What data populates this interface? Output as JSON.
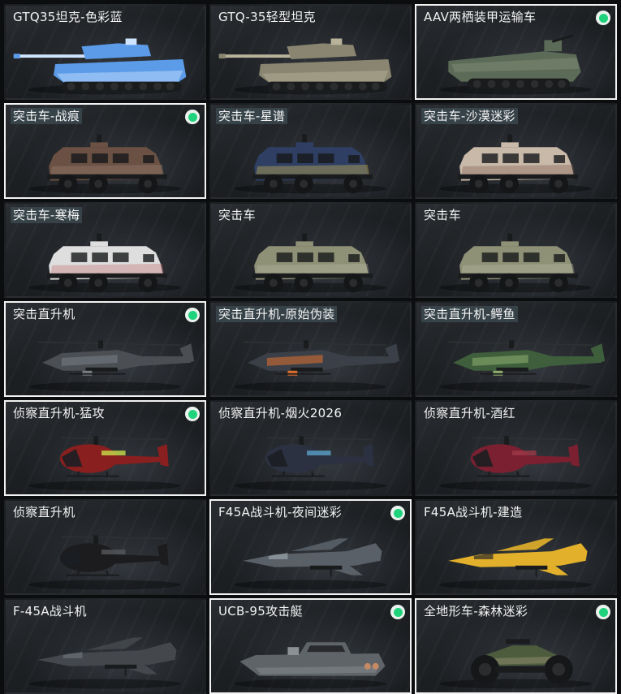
{
  "items": [
    {
      "name": "GTQ35坦克-色彩蓝",
      "kind": "tank",
      "tint": "#5b9be8",
      "accent": "#cfe4ff",
      "owned": false,
      "selected": false,
      "tagged": false
    },
    {
      "name": "GTQ-35轻型坦克",
      "kind": "tank",
      "tint": "#8a8570",
      "accent": "#b9b39b",
      "owned": false,
      "selected": false,
      "tagged": false
    },
    {
      "name": "AAV两栖装甲运输车",
      "kind": "aav",
      "tint": "#5c6b57",
      "accent": "#7f8e78",
      "owned": true,
      "selected": true,
      "tagged": false
    },
    {
      "name": "突击车-战痕",
      "kind": "truck",
      "tint": "#6a5143",
      "accent": "#9b8575",
      "owned": true,
      "selected": true,
      "tagged": true
    },
    {
      "name": "突击车-星谱",
      "kind": "truck",
      "tint": "#2f3f63",
      "accent": "#e2c24e",
      "owned": false,
      "selected": false,
      "tagged": true
    },
    {
      "name": "突击车-沙漠迷彩",
      "kind": "truck",
      "tint": "#c9b9a9",
      "accent": "#7a5a4a",
      "owned": false,
      "selected": false,
      "tagged": true
    },
    {
      "name": "突击车-寒梅",
      "kind": "truck",
      "tint": "#dedede",
      "accent": "#c36b6b",
      "owned": false,
      "selected": false,
      "tagged": true
    },
    {
      "name": "突击车",
      "kind": "truck",
      "tint": "#8f9177",
      "accent": "#b8b9a2",
      "owned": false,
      "selected": false,
      "tagged": false
    },
    {
      "name": "突击车",
      "kind": "truck",
      "tint": "#8f9177",
      "accent": "#b8b9a2",
      "owned": false,
      "selected": false,
      "tagged": false
    },
    {
      "name": "突击直升机",
      "kind": "attack-heli",
      "tint": "#4b4f54",
      "accent": "#7a7f85",
      "owned": true,
      "selected": true,
      "tagged": false
    },
    {
      "name": "突击直升机-原始伪装",
      "kind": "attack-heli",
      "tint": "#3b4048",
      "accent": "#e0702e",
      "owned": false,
      "selected": false,
      "tagged": true
    },
    {
      "name": "突击直升机-鳄鱼",
      "kind": "attack-heli",
      "tint": "#3f5e3c",
      "accent": "#8fb06f",
      "owned": false,
      "selected": false,
      "tagged": true
    },
    {
      "name": "侦察直升机-猛攻",
      "kind": "scout-heli",
      "tint": "#8a1f1f",
      "accent": "#c8e04a",
      "owned": true,
      "selected": true,
      "tagged": false
    },
    {
      "name": "侦察直升机-烟火2026",
      "kind": "scout-heli",
      "tint": "#2b3140",
      "accent": "#5aa0c8",
      "owned": false,
      "selected": false,
      "tagged": false
    },
    {
      "name": "侦察直升机-酒红",
      "kind": "scout-heli",
      "tint": "#7a2030",
      "accent": "#a03848",
      "owned": false,
      "selected": false,
      "tagged": false
    },
    {
      "name": "侦察直升机",
      "kind": "scout-heli",
      "tint": "#1c1c1e",
      "accent": "#55575b",
      "owned": false,
      "selected": false,
      "tagged": false
    },
    {
      "name": "F45A战斗机-夜间迷彩",
      "kind": "jet",
      "tint": "#596068",
      "accent": "#9aa2aa",
      "owned": true,
      "selected": true,
      "tagged": false
    },
    {
      "name": "F45A战斗机-建造",
      "kind": "jet",
      "tint": "#e2b02a",
      "accent": "#2a2a2a",
      "owned": false,
      "selected": false,
      "tagged": false
    },
    {
      "name": "F-45A战斗机",
      "kind": "jet",
      "tint": "#44484d",
      "accent": "#6b7077",
      "owned": false,
      "selected": false,
      "tagged": false
    },
    {
      "name": "UCB-95攻击艇",
      "kind": "boat",
      "tint": "#5f6468",
      "accent": "#8c9196",
      "owned": true,
      "selected": true,
      "tagged": false
    },
    {
      "name": "全地形车-森林迷彩",
      "kind": "atv",
      "tint": "#4e5c3e",
      "accent": "#8a8a6a",
      "owned": true,
      "selected": true,
      "tagged": false
    }
  ]
}
